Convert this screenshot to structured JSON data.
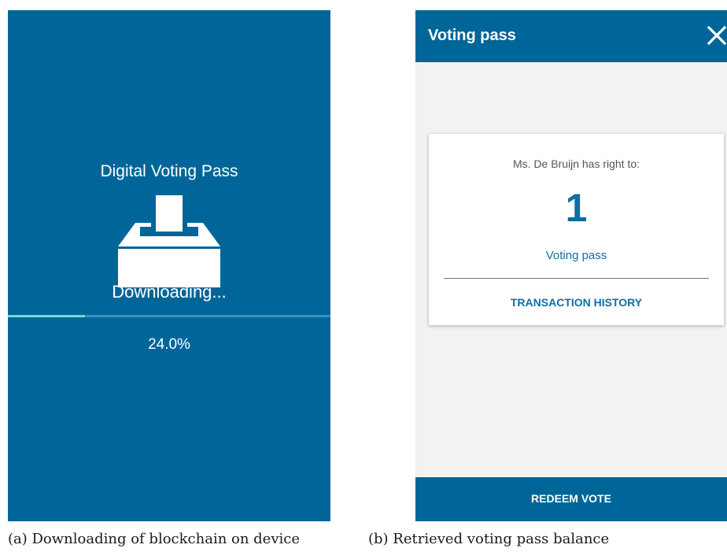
{
  "screen_a": {
    "title": "Digital Voting Pass",
    "status": "Downloading...",
    "progress_text": "24.0%",
    "progress_fraction": 0.24,
    "icon": "ballot-box-icon",
    "colors": {
      "background": "#006699",
      "progress": "#7fd6cf"
    }
  },
  "screen_b": {
    "app_bar": {
      "title": "Voting pass",
      "close_icon": "close-icon"
    },
    "card": {
      "label": "Ms. De  Bruijn has right to:",
      "count": "1",
      "unit": "Voting pass",
      "history_link": "TRANSACTION HISTORY"
    },
    "bottom_button": "REDEEM VOTE",
    "colors": {
      "primary": "#006699",
      "accent_text": "#0e6ea5",
      "background": "#f2f2f2"
    }
  },
  "captions": {
    "a": "(a) Downloading of blockchain on device",
    "b": "(b) Retrieved voting pass balance"
  }
}
